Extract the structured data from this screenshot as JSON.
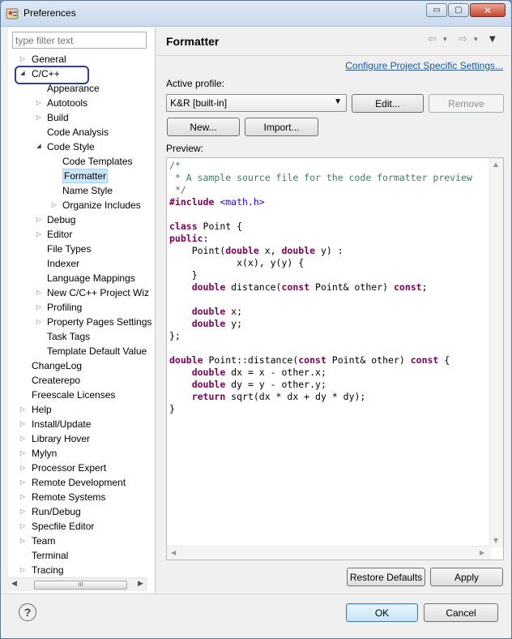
{
  "window": {
    "title": "Preferences",
    "controls": {
      "minimize": "▭",
      "maximize": "▢",
      "close": "✕"
    }
  },
  "filter": {
    "placeholder": "type filter text"
  },
  "tree": [
    {
      "label": "General",
      "depth": 0,
      "expander": "collapsed"
    },
    {
      "label": "C/C++",
      "depth": 0,
      "expander": "expanded"
    },
    {
      "label": "Appearance",
      "depth": 1,
      "expander": "none"
    },
    {
      "label": "Autotools",
      "depth": 1,
      "expander": "collapsed"
    },
    {
      "label": "Build",
      "depth": 1,
      "expander": "collapsed"
    },
    {
      "label": "Code Analysis",
      "depth": 1,
      "expander": "none"
    },
    {
      "label": "Code Style",
      "depth": 1,
      "expander": "expanded"
    },
    {
      "label": "Code Templates",
      "depth": 2,
      "expander": "none"
    },
    {
      "label": "Formatter",
      "depth": 2,
      "expander": "none",
      "selected": true
    },
    {
      "label": "Name Style",
      "depth": 2,
      "expander": "none"
    },
    {
      "label": "Organize Includes",
      "depth": 2,
      "expander": "collapsed"
    },
    {
      "label": "Debug",
      "depth": 1,
      "expander": "collapsed"
    },
    {
      "label": "Editor",
      "depth": 1,
      "expander": "collapsed"
    },
    {
      "label": "File Types",
      "depth": 1,
      "expander": "none"
    },
    {
      "label": "Indexer",
      "depth": 1,
      "expander": "none"
    },
    {
      "label": "Language Mappings",
      "depth": 1,
      "expander": "none"
    },
    {
      "label": "New C/C++ Project Wiz",
      "depth": 1,
      "expander": "collapsed"
    },
    {
      "label": "Profiling",
      "depth": 1,
      "expander": "collapsed"
    },
    {
      "label": "Property Pages Settings",
      "depth": 1,
      "expander": "collapsed"
    },
    {
      "label": "Task Tags",
      "depth": 1,
      "expander": "none"
    },
    {
      "label": "Template Default Value",
      "depth": 1,
      "expander": "none"
    },
    {
      "label": "ChangeLog",
      "depth": 0,
      "expander": "none"
    },
    {
      "label": "Createrepo",
      "depth": 0,
      "expander": "none"
    },
    {
      "label": "Freescale Licenses",
      "depth": 0,
      "expander": "none"
    },
    {
      "label": "Help",
      "depth": 0,
      "expander": "collapsed"
    },
    {
      "label": "Install/Update",
      "depth": 0,
      "expander": "collapsed"
    },
    {
      "label": "Library Hover",
      "depth": 0,
      "expander": "collapsed"
    },
    {
      "label": "Mylyn",
      "depth": 0,
      "expander": "collapsed"
    },
    {
      "label": "Processor Expert",
      "depth": 0,
      "expander": "collapsed"
    },
    {
      "label": "Remote Development",
      "depth": 0,
      "expander": "collapsed"
    },
    {
      "label": "Remote Systems",
      "depth": 0,
      "expander": "collapsed"
    },
    {
      "label": "Run/Debug",
      "depth": 0,
      "expander": "collapsed"
    },
    {
      "label": "Specfile Editor",
      "depth": 0,
      "expander": "collapsed"
    },
    {
      "label": "Team",
      "depth": 0,
      "expander": "collapsed"
    },
    {
      "label": "Terminal",
      "depth": 0,
      "expander": "none"
    },
    {
      "label": "Tracing",
      "depth": 0,
      "expander": "collapsed"
    }
  ],
  "tree_scroll": {
    "grip": "III"
  },
  "page": {
    "title": "Formatter",
    "nav": {
      "back": "⇦",
      "back_menu": "▾",
      "forward": "⇨",
      "forward_menu": "▾",
      "view_menu": "▼"
    },
    "config_link": "Configure Project Specific Settings...",
    "active_profile_label": "Active profile:",
    "profile_value": "K&R [built-in]",
    "edit_button": "Edit...",
    "remove_button": "Remove",
    "new_button": "New...",
    "import_button": "Import...",
    "preview_label": "Preview:",
    "restore_button": "Restore Defaults",
    "apply_button": "Apply"
  },
  "preview_code": [
    [
      [
        "cm",
        "/*"
      ]
    ],
    [
      [
        "cm",
        " * A sample source file for the code formatter preview"
      ]
    ],
    [
      [
        "cm",
        " */"
      ]
    ],
    [
      [
        "kw",
        "#include"
      ],
      [
        "",
        " "
      ],
      [
        "str",
        "<math.h>"
      ]
    ],
    [],
    [
      [
        "kw",
        "class"
      ],
      [
        "",
        " Point {"
      ]
    ],
    [
      [
        "kw",
        "public"
      ],
      [
        "",
        ":"
      ]
    ],
    [
      [
        "",
        "    Point("
      ],
      [
        "kw",
        "double"
      ],
      [
        "",
        " x, "
      ],
      [
        "kw",
        "double"
      ],
      [
        "",
        " y) :"
      ]
    ],
    [
      [
        "",
        "            x(x), y(y) {"
      ]
    ],
    [
      [
        "",
        "    }"
      ]
    ],
    [
      [
        "",
        "    "
      ],
      [
        "kw",
        "double"
      ],
      [
        "",
        " distance("
      ],
      [
        "kw",
        "const"
      ],
      [
        "",
        " Point& other) "
      ],
      [
        "kw",
        "const"
      ],
      [
        "",
        ";"
      ]
    ],
    [],
    [
      [
        "",
        "    "
      ],
      [
        "kw",
        "double"
      ],
      [
        "",
        " x;"
      ]
    ],
    [
      [
        "",
        "    "
      ],
      [
        "kw",
        "double"
      ],
      [
        "",
        " y;"
      ]
    ],
    [
      [
        "",
        "};"
      ]
    ],
    [],
    [
      [
        "kw",
        "double"
      ],
      [
        "",
        " Point::distance("
      ],
      [
        "kw",
        "const"
      ],
      [
        "",
        " Point& other) "
      ],
      [
        "kw",
        "const"
      ],
      [
        "",
        " {"
      ]
    ],
    [
      [
        "",
        "    "
      ],
      [
        "kw",
        "double"
      ],
      [
        "",
        " dx = x - other.x;"
      ]
    ],
    [
      [
        "",
        "    "
      ],
      [
        "kw",
        "double"
      ],
      [
        "",
        " dy = y - other.y;"
      ]
    ],
    [
      [
        "",
        "    "
      ],
      [
        "kw",
        "return"
      ],
      [
        "",
        " sqrt(dx * dx + dy * dy);"
      ]
    ],
    [
      [
        "",
        "}"
      ]
    ]
  ],
  "footer": {
    "help_icon": "?",
    "ok_button": "OK",
    "cancel_button": "Cancel"
  }
}
